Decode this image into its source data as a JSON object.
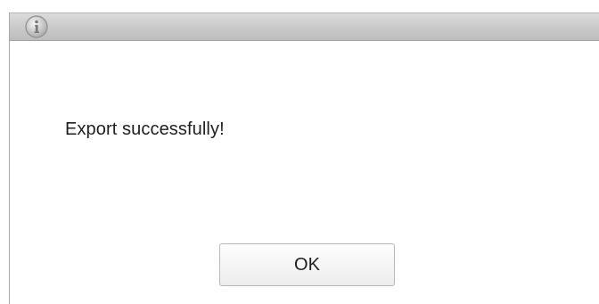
{
  "dialog": {
    "icon": "info-icon",
    "message": "Export successfully!",
    "ok_label": "OK"
  }
}
